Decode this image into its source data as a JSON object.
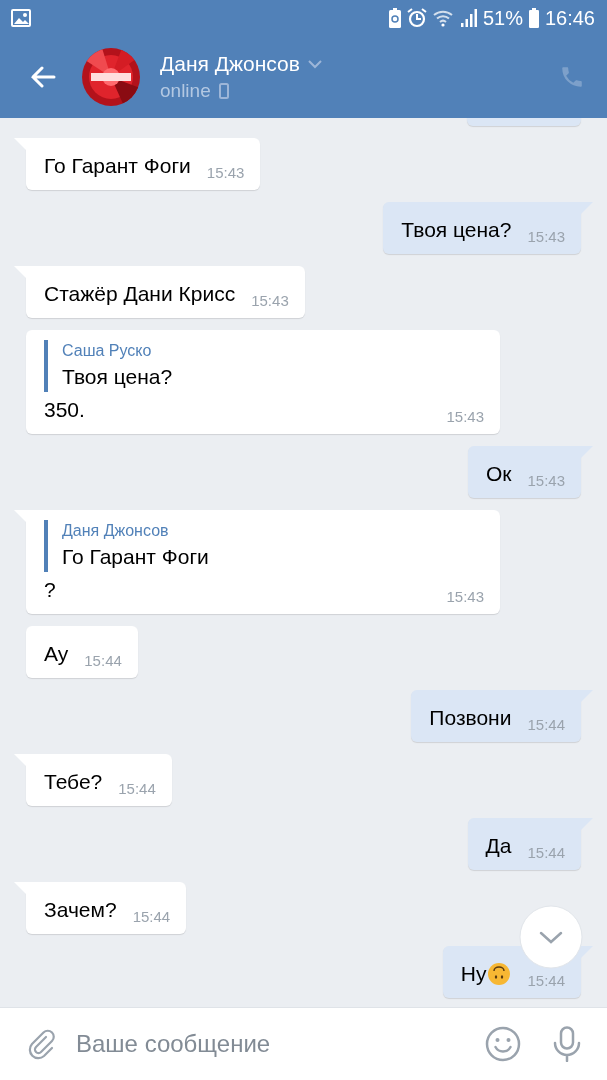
{
  "status_bar": {
    "battery_percent": "51%",
    "time": "16:46"
  },
  "header": {
    "contact_name": "Даня Джонсов",
    "presence": "online",
    "call_enabled": false
  },
  "messages": [
    {
      "outgoing": true,
      "kind": "clipped",
      "tail": false
    },
    {
      "outgoing": false,
      "kind": "text",
      "tail": true,
      "text": "Го Гарант Фоги",
      "time": "15:43"
    },
    {
      "outgoing": true,
      "kind": "text",
      "tail": true,
      "text": "Твоя цена?",
      "time": "15:43"
    },
    {
      "outgoing": false,
      "kind": "text",
      "tail": true,
      "text": "Стажёр Дани Крисс",
      "time": "15:43"
    },
    {
      "outgoing": false,
      "kind": "reply",
      "tail": false,
      "quote_author": "Саша Руско",
      "quote_text": "Твоя цена?",
      "text": "350.",
      "time": "15:43"
    },
    {
      "outgoing": true,
      "kind": "text",
      "tail": true,
      "text": "Ок",
      "time": "15:43"
    },
    {
      "outgoing": false,
      "kind": "reply",
      "tail": true,
      "quote_author": "Даня Джонсов",
      "quote_text": "Го Гарант Фоги",
      "text": "?",
      "time": "15:43"
    },
    {
      "outgoing": false,
      "kind": "text",
      "tail": false,
      "text": "Ау",
      "time": "15:44"
    },
    {
      "outgoing": true,
      "kind": "text",
      "tail": true,
      "text": "Позвони",
      "time": "15:44"
    },
    {
      "outgoing": false,
      "kind": "text",
      "tail": true,
      "text": "Тебе?",
      "time": "15:44"
    },
    {
      "outgoing": true,
      "kind": "text",
      "tail": true,
      "text": "Да",
      "time": "15:44"
    },
    {
      "outgoing": false,
      "kind": "text",
      "tail": true,
      "text": "Зачем?",
      "time": "15:44"
    },
    {
      "outgoing": true,
      "kind": "emoji",
      "tail": true,
      "text": "Ну",
      "time": "15:44"
    }
  ],
  "composer": {
    "placeholder": "Ваше сообщение"
  }
}
